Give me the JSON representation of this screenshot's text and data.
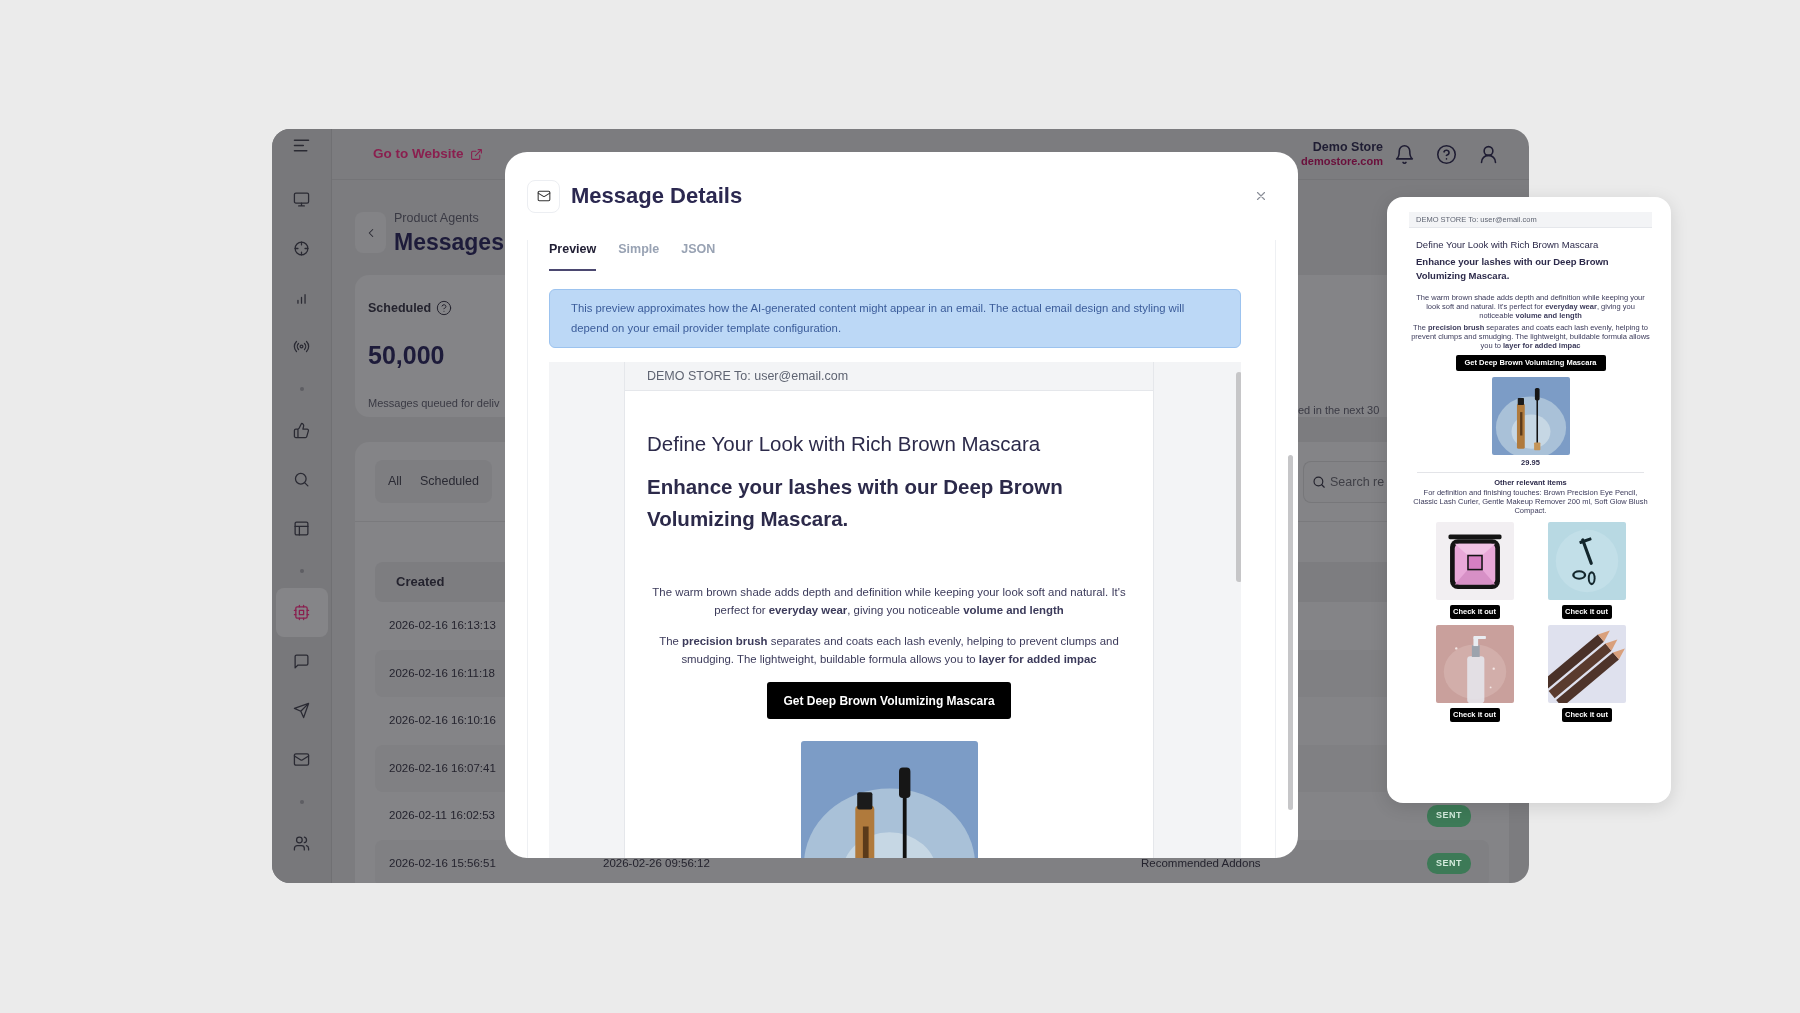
{
  "sidebar": {
    "items": [
      {
        "kind": "monitor",
        "selected": false
      },
      {
        "kind": "crosshair",
        "selected": false
      },
      {
        "kind": "bar-chart",
        "selected": false
      },
      {
        "kind": "broadcast",
        "selected": false
      },
      {
        "kind": "divider"
      },
      {
        "kind": "thumbs-up",
        "selected": false
      },
      {
        "kind": "search",
        "selected": false
      },
      {
        "kind": "layout",
        "selected": false
      },
      {
        "kind": "divider"
      },
      {
        "kind": "chip",
        "selected": true
      },
      {
        "kind": "chat",
        "selected": false
      },
      {
        "kind": "send",
        "selected": false
      },
      {
        "kind": "mail",
        "selected": false
      },
      {
        "kind": "divider"
      },
      {
        "kind": "users",
        "selected": false
      }
    ]
  },
  "header": {
    "website_link": "Go to Website",
    "store_name": "Demo Store",
    "store_domain": "demostore.com"
  },
  "page": {
    "breadcrumb": "Product Agents",
    "title": "Messages"
  },
  "stats": {
    "label": "Scheduled",
    "value": "50,000",
    "caption": "Messages queued for deliv",
    "caption_2": "ed in the next 30"
  },
  "filter_tabs": [
    {
      "label": "All",
      "selected": false
    },
    {
      "label": "Scheduled",
      "selected": false
    }
  ],
  "search": {
    "placeholder": "Search re"
  },
  "table": {
    "columns": [
      "Created"
    ],
    "rows": [
      {
        "created": "2026-02-16 16:13:13"
      },
      {
        "created": "2026-02-16 16:11:18"
      },
      {
        "created": "2026-02-16 16:10:16"
      },
      {
        "created": "2026-02-16 16:07:41"
      },
      {
        "created": "2026-02-11 16:02:53",
        "status": "SENT"
      },
      {
        "created": "2026-02-16 15:56:51",
        "column_2": "2026-02-26 09:56:12",
        "column_4": "Recommended Addons",
        "status": "SENT"
      }
    ]
  },
  "modal": {
    "title": "Message Details",
    "tabs": [
      {
        "label": "Preview",
        "selected": true
      },
      {
        "label": "Simple",
        "selected": false
      },
      {
        "label": "JSON",
        "selected": false
      }
    ],
    "notice": "This preview approximates how the AI-generated content might appear in an email. The actual email design and styling will depend on your email provider template configuration.",
    "email": {
      "header": "DEMO STORE To: user@email.com",
      "headline": "Define Your Look with Rich Brown Mascara",
      "subheadline": "Enhance your lashes with our Deep Brown Volumizing Mascara.",
      "paragraphs": [
        "The warm brown shade adds depth and definition while keeping your look soft and natural. It's perfect for **everyday wear**, giving you noticeable **volume and length**",
        "The **precision brush** separates and coats each lash evenly, helping to prevent clumps and smudging. The lightweight, buildable formula allows you to **layer for added impac**"
      ],
      "cta": "Get Deep Brown Volumizing Mascara"
    }
  },
  "side_preview": {
    "email": {
      "header": "DEMO STORE To: user@email.com",
      "headline": "Define Your Look with Rich Brown Mascara",
      "subheadline": "Enhance your lashes with our Deep Brown Volumizing Mascara.",
      "paragraphs": [
        "The warm brown shade adds depth and definition while keeping your look soft and natural. It's perfect for **everyday wear**, giving you noticeable **volume and length**",
        "The **precision brush** separates and coats each lash evenly, helping to prevent clumps and smudging. The lightweight, buildable formula allows you to **layer for added impac**"
      ],
      "cta": "Get Deep Brown Volumizing Mascara",
      "price": "29.95",
      "related_title": "Other relevant items",
      "related_text": "For definition and finishing touches: Brown Precision Eye Pencil, Classic Lash Curler, Gentle Makeup Remover 200 ml, Soft Glow Blush Compact.",
      "related": [
        {
          "button": "Check it out"
        },
        {
          "button": "Check it out"
        },
        {
          "button": "Check it out"
        },
        {
          "button": "Check it out"
        }
      ]
    }
  }
}
